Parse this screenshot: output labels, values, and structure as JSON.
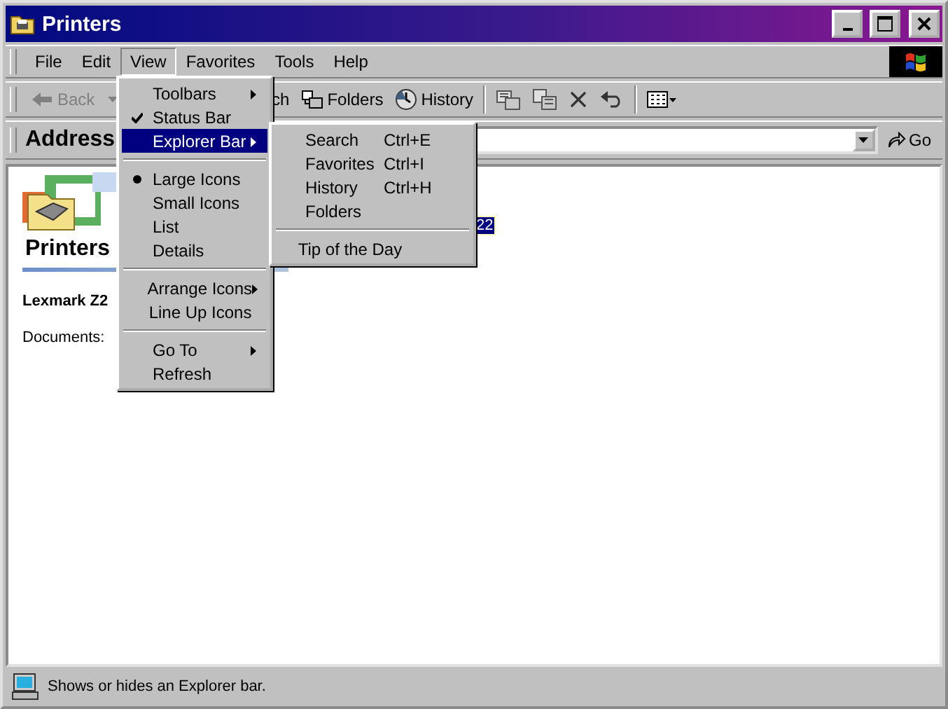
{
  "window": {
    "title": "Printers"
  },
  "menu_bar": [
    {
      "label": "File",
      "selected": false
    },
    {
      "label": "Edit",
      "selected": false
    },
    {
      "label": "View",
      "selected": true
    },
    {
      "label": "Favorites",
      "selected": false
    },
    {
      "label": "Tools",
      "selected": false
    },
    {
      "label": "Help",
      "selected": false
    }
  ],
  "toolbar": [
    {
      "kind": "back",
      "label": "Back",
      "disabled": true
    },
    {
      "kind": "search",
      "label": "ch",
      "disabled": false
    },
    {
      "kind": "folders",
      "label": "Folders",
      "disabled": false
    },
    {
      "kind": "history",
      "label": "History",
      "disabled": false
    },
    {
      "kind": "move"
    },
    {
      "kind": "copy"
    },
    {
      "kind": "delete"
    },
    {
      "kind": "undo"
    },
    {
      "kind": "views"
    }
  ],
  "address_bar": {
    "label": "Address",
    "go": "Go"
  },
  "content": {
    "heading": "Printers",
    "item_name": "Lexmark Z2",
    "documents": "Documents:",
    "selected_item": {
      "label": "22",
      "selected": true
    }
  },
  "view_menu": [
    {
      "kind": "item",
      "label": "Toolbars",
      "submenu": true,
      "checked": false,
      "highlighted": false
    },
    {
      "kind": "check",
      "label": "Status Bar",
      "submenu": false,
      "checked": true,
      "highlighted": false
    },
    {
      "kind": "item",
      "label": "Explorer Bar",
      "submenu": true,
      "checked": false,
      "highlighted": true
    },
    {
      "kind": "separator"
    },
    {
      "kind": "radio",
      "label": "Large Icons",
      "submenu": false,
      "checked": true,
      "highlighted": false
    },
    {
      "kind": "radio",
      "label": "Small Icons",
      "submenu": false,
      "checked": false,
      "highlighted": false
    },
    {
      "kind": "radio",
      "label": "List",
      "submenu": false,
      "checked": false,
      "highlighted": false
    },
    {
      "kind": "radio",
      "label": "Details",
      "submenu": false,
      "checked": false,
      "highlighted": false
    },
    {
      "kind": "separator"
    },
    {
      "kind": "item",
      "label": "Arrange Icons",
      "submenu": true,
      "checked": false,
      "highlighted": false
    },
    {
      "kind": "item",
      "label": "Line Up Icons",
      "submenu": false,
      "checked": false,
      "highlighted": false
    },
    {
      "kind": "separator"
    },
    {
      "kind": "item",
      "label": "Go To",
      "submenu": true,
      "checked": false,
      "highlighted": false
    },
    {
      "kind": "item",
      "label": "Refresh",
      "submenu": false,
      "checked": false,
      "highlighted": false
    }
  ],
  "explorer_bar_menu": [
    {
      "kind": "item",
      "label": "Search",
      "shortcut": "Ctrl+E",
      "submenu": false,
      "checked": false,
      "highlighted": false
    },
    {
      "kind": "item",
      "label": "Favorites",
      "shortcut": "Ctrl+I",
      "submenu": false,
      "checked": false,
      "highlighted": false
    },
    {
      "kind": "item",
      "label": "History",
      "shortcut": "Ctrl+H",
      "submenu": false,
      "checked": false,
      "highlighted": false
    },
    {
      "kind": "item",
      "label": "Folders",
      "submenu": false,
      "checked": false,
      "highlighted": false
    },
    {
      "kind": "separator"
    },
    {
      "kind": "item",
      "label": "Tip of the Day",
      "submenu": false,
      "checked": false,
      "highlighted": false
    }
  ],
  "status_bar": {
    "text": "Shows or hides an Explorer bar."
  }
}
